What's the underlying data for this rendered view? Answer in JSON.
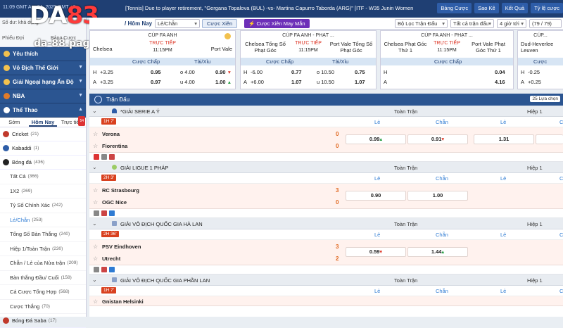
{
  "topbar": {
    "time": "11:09 GMT Apr 04, 2025 GMT +7",
    "ticker": "[Tennis] Due to player retirement, \"Gergana Topalova (BUL) -vs- Martina Capurro Taborda (ARG)\" [ITF - W35 Junin Women",
    "buttons": [
      "Bảng Cược",
      "Sao Kê",
      "Kết Quả",
      "Tỷ lệ cược"
    ]
  },
  "logo": {
    "brand_a": "DA",
    "brand_b": "83",
    "domain": "da-88.page"
  },
  "sidebar": {
    "top_a": "Số dư: khả dụng",
    "top_b": "Phiếu Đợi",
    "top_c": "Bảng Cược",
    "sections": [
      {
        "label": "Yêu thích"
      },
      {
        "label": "Vô Địch Thế Giới"
      },
      {
        "label": "Giải Ngoại hạng Ấn Độ"
      },
      {
        "label": "NBA"
      },
      {
        "label": "Thể Thao"
      }
    ],
    "tabs": [
      "Sớm",
      "Hôm Nay",
      "Trực tiếp"
    ],
    "tab_badge": "54",
    "items": [
      {
        "label": "Cricket",
        "count": "(21)",
        "color": "#c0392b"
      },
      {
        "label": "Kabaddi",
        "count": "(1)",
        "color": "#2e5da8"
      },
      {
        "label": "Bóng đá",
        "count": "(436)",
        "color": "#222222"
      }
    ],
    "subitems": [
      {
        "label": "Tất Cả",
        "count": "(366)"
      },
      {
        "label": "1X2",
        "count": "(269)"
      },
      {
        "label": "Tỷ Số Chính Xác",
        "count": "(242)"
      },
      {
        "label": "Lẻ/Chẵn",
        "count": "(253)"
      },
      {
        "label": "Tổng Số Bàn Thắng",
        "count": "(240)"
      },
      {
        "label": "Hiệp 1/Toàn Trận",
        "count": "(230)"
      },
      {
        "label": "Chẵn / Lẻ của Nửa trận",
        "count": "(209)"
      },
      {
        "label": "Bàn thắng Đầu/ Cuối",
        "count": "(158)"
      },
      {
        "label": "Cá Cược Tổng Hợp",
        "count": "(568)"
      },
      {
        "label": "Cược Thắng",
        "count": "(70)"
      }
    ],
    "bottom_item": {
      "label": "Bóng Đá Saba",
      "count": "(17)"
    }
  },
  "nav": {
    "crumb": "/ Hôm Nay",
    "select1": "Lẻ/Chẵn",
    "xien": "Cược Xiên",
    "xien_random": "Cược Xiên May Mắn",
    "filter1": "Bộ Lọc Trận Đấu",
    "filter2": "Tất cả trận đấu",
    "filter3": "4 giờ tới",
    "pager": "(79 / 79)"
  },
  "cards": [
    {
      "league": "CÚP FA ANH",
      "team1": "Chelsea",
      "team2": "Port Vale",
      "status": "TRỰC TIẾP",
      "time": "11:15PM",
      "h_label": "Cược Chấp",
      "ou_label": "Tài/Xỉu",
      "r1": [
        "H",
        "+3.25",
        "0.95",
        "o 4.00",
        "0.90"
      ],
      "r2": [
        "A",
        "+3.25",
        "0.97",
        "u 4.00",
        "1.00"
      ]
    },
    {
      "league": "CÚP FA ANH - PHẠT ...",
      "team1": "Chelsea Tổng Số Phạt Góc",
      "team2": "Port Vale Tổng Số Phạt Góc",
      "status": "TRỰC TIẾP",
      "time": "11:15PM",
      "h_label": "Cược Chấp",
      "ou_label": "Tài/Xỉu",
      "r1": [
        "H",
        "-6.00",
        "0.77",
        "o 10.50",
        "0.75"
      ],
      "r2": [
        "A",
        "+6.00",
        "1.07",
        "u 10.50",
        "1.07"
      ]
    },
    {
      "league": "CÚP FA ANH - PHẠT ...",
      "team1": "Chelsea Phạt Góc Thứ 1",
      "team2": "Port Vale Phạt Góc Thứ 1",
      "status": "TRỰC TIẾP",
      "time": "11:15PM",
      "h_label": "Cược Chấp",
      "r1": [
        "H",
        "0.04"
      ],
      "r2": [
        "A",
        "4.16"
      ]
    },
    {
      "league": "CÚP...",
      "team1": "Dud-Heverlee Leuven",
      "h_label": "Cược",
      "r1": [
        "H",
        "-0.25"
      ],
      "r2": [
        "A",
        "+0.25"
      ]
    }
  ],
  "main": {
    "title": "Trận Đấu",
    "right_label": "25 Lựa chọn",
    "full_label": "Toàn Trận",
    "half_label": "Hiệp 1",
    "le_label": "Lẻ",
    "chan_label": "Chẵn",
    "leagues": [
      {
        "name": "*GIẢI SERIE A Ý",
        "live": "1H 7'",
        "home": "Verona",
        "away": "Fiorentina",
        "hs": "0",
        "as": "0",
        "odd_le": "0.99",
        "odd_chan": "0.91",
        "odd_h1": "1.31"
      },
      {
        "name": "GIẢI LIGUE 1 PHÁP",
        "live": "2H 3'",
        "home": "RC Strasbourg",
        "away": "OGC Nice",
        "hs": "3",
        "as": "0",
        "odd_le": "0.90",
        "odd_chan": "1.00"
      },
      {
        "name": "GIẢI VÔ ĐỊCH QUỐC GIA HÀ LAN",
        "live": "2H 36'",
        "home": "PSV Eindhoven",
        "away": "Utrecht",
        "hs": "3",
        "as": "2",
        "odd_le": "0.59",
        "odd_chan": "1.44"
      },
      {
        "name": "GIẢI VÔ ĐỊCH QUỐC GIA PHẦN LAN",
        "live": "1H 7'",
        "home": "Gnistan Helsinki"
      }
    ]
  }
}
